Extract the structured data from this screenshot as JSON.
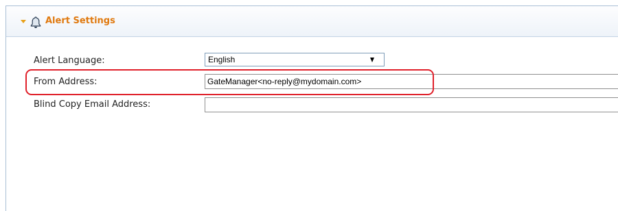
{
  "panel": {
    "title": "Alert Settings",
    "collapse_icon": "chevron-down-icon",
    "header_icon": "bell-icon",
    "accent_color": "#e07a10",
    "highlight_color": "#e0202a"
  },
  "form": {
    "alert_language": {
      "label": "Alert Language:",
      "selected": "English"
    },
    "from_address": {
      "label": "From Address:",
      "value": "GateManager<no-reply@mydomain.com>"
    },
    "bcc_address": {
      "label": "Blind Copy Email Address:",
      "value": ""
    }
  }
}
